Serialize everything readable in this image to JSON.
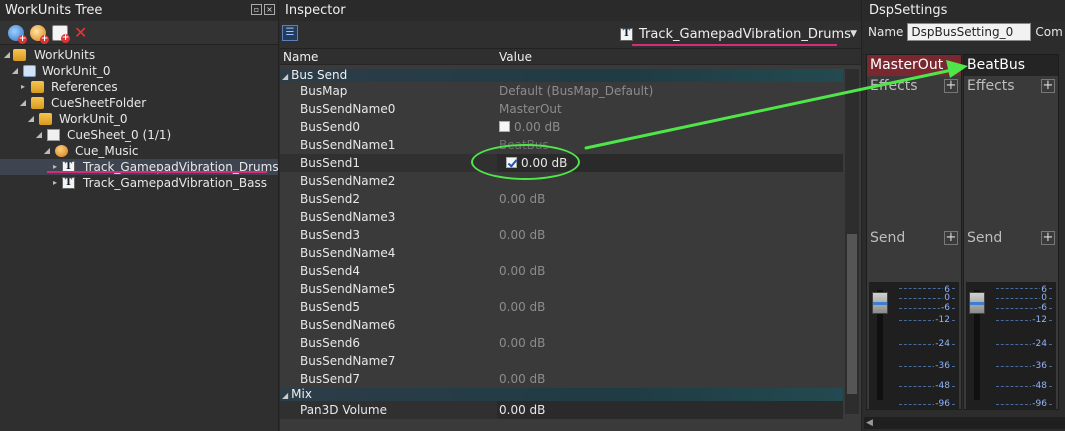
{
  "tree": {
    "title": "WorkUnits Tree",
    "items": [
      {
        "label": "WorkUnits",
        "icon": "folder-icon"
      },
      {
        "label": "WorkUnit_0",
        "icon": "workunit-icon"
      },
      {
        "label": "References",
        "icon": "folder-icon"
      },
      {
        "label": "CueSheetFolder",
        "icon": "folder-icon"
      },
      {
        "label": "WorkUnit_0",
        "icon": "folder-icon"
      },
      {
        "label": "CueSheet_0 (1/1)",
        "icon": "cuesheet-icon"
      },
      {
        "label": "Cue_Music",
        "icon": "cue-icon"
      },
      {
        "label": "Track_GamepadVibration_Drums",
        "icon": "track-icon"
      },
      {
        "label": "Track_GamepadVibration_Bass",
        "icon": "track-icon"
      }
    ]
  },
  "inspector": {
    "title": "Inspector",
    "target": "Track_GamepadVibration_Drums",
    "track_glyph": "T",
    "col_name": "Name",
    "col_value": "Value",
    "sections": [
      {
        "label": "Bus Send",
        "rows": [
          {
            "name": "BusMap",
            "value": "Default (BusMap_Default)"
          },
          {
            "name": "BusSendName0",
            "value": "MasterOut"
          },
          {
            "name": "BusSend0",
            "value": "0.00 dB",
            "checkbox": false
          },
          {
            "name": "BusSendName1",
            "value": "BeatBus"
          },
          {
            "name": "BusSend1",
            "value": "0.00 dB",
            "checkbox": true
          },
          {
            "name": "BusSendName2",
            "value": ""
          },
          {
            "name": "BusSend2",
            "value": "0.00 dB"
          },
          {
            "name": "BusSendName3",
            "value": ""
          },
          {
            "name": "BusSend3",
            "value": "0.00 dB"
          },
          {
            "name": "BusSendName4",
            "value": ""
          },
          {
            "name": "BusSend4",
            "value": "0.00 dB"
          },
          {
            "name": "BusSendName5",
            "value": ""
          },
          {
            "name": "BusSend5",
            "value": "0.00 dB"
          },
          {
            "name": "BusSendName6",
            "value": ""
          },
          {
            "name": "BusSend6",
            "value": "0.00 dB"
          },
          {
            "name": "BusSendName7",
            "value": ""
          },
          {
            "name": "BusSend7",
            "value": "0.00 dB"
          }
        ]
      },
      {
        "label": "Mix",
        "rows": [
          {
            "name": "Pan3D Volume",
            "value": "0.00 dB"
          }
        ]
      }
    ]
  },
  "dsp": {
    "title": "DspSettings",
    "name_label": "Name",
    "name_value": "DspBusSetting_0",
    "com_label": "Com",
    "buses": [
      {
        "title": "MasterOut",
        "effects": "Effects",
        "send": "Send",
        "add": "+"
      },
      {
        "title": "BeatBus",
        "effects": "Effects",
        "send": "Send",
        "add": "+"
      }
    ],
    "scale": [
      "6",
      "0",
      "-6",
      "-12",
      "-24",
      "-36",
      "-48",
      "-96"
    ]
  },
  "colors": {
    "annotation_green": "#4fe64a",
    "underline_pink": "#d62b7a",
    "master_bus": "#7a2830"
  }
}
